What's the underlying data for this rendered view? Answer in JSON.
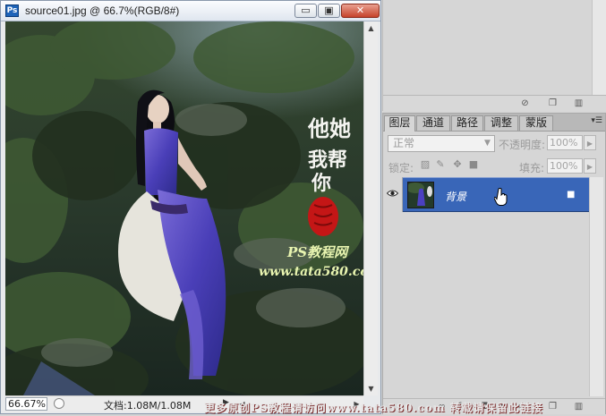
{
  "document": {
    "title": "source01.jpg @ 66.7%(RGB/8#)",
    "app_icon_label": "Ps",
    "buttons": {
      "minimize": "▭",
      "maximize": "▣",
      "close": "✕"
    },
    "zoom": "66.67%",
    "doc_size": "文档:1.08M/1.08M",
    "watermark": {
      "calligraphy": [
        "他她",
        "我帮",
        "你"
      ],
      "site_name": "PS教程网",
      "site_url": "www.tata580.com"
    }
  },
  "layers_panel": {
    "tabs": [
      "图层",
      "通道",
      "路径",
      "调整",
      "蒙版"
    ],
    "active_tab": "图层",
    "blend_mode": "正常",
    "opacity_label": "不透明度:",
    "opacity_value": "100%",
    "lock_label": "锁定:",
    "fill_label": "填充:",
    "fill_value": "100%",
    "layers": [
      {
        "name": "背景",
        "visible": true,
        "locked": true,
        "selected": true
      }
    ]
  },
  "footer_watermark": "更多原创PS教程请访问www.tata580.com 转载请保留此链接",
  "colors": {
    "selection": "#3966b8",
    "panel_bg": "#d6d6d6",
    "window_border": "#8a98ab"
  }
}
